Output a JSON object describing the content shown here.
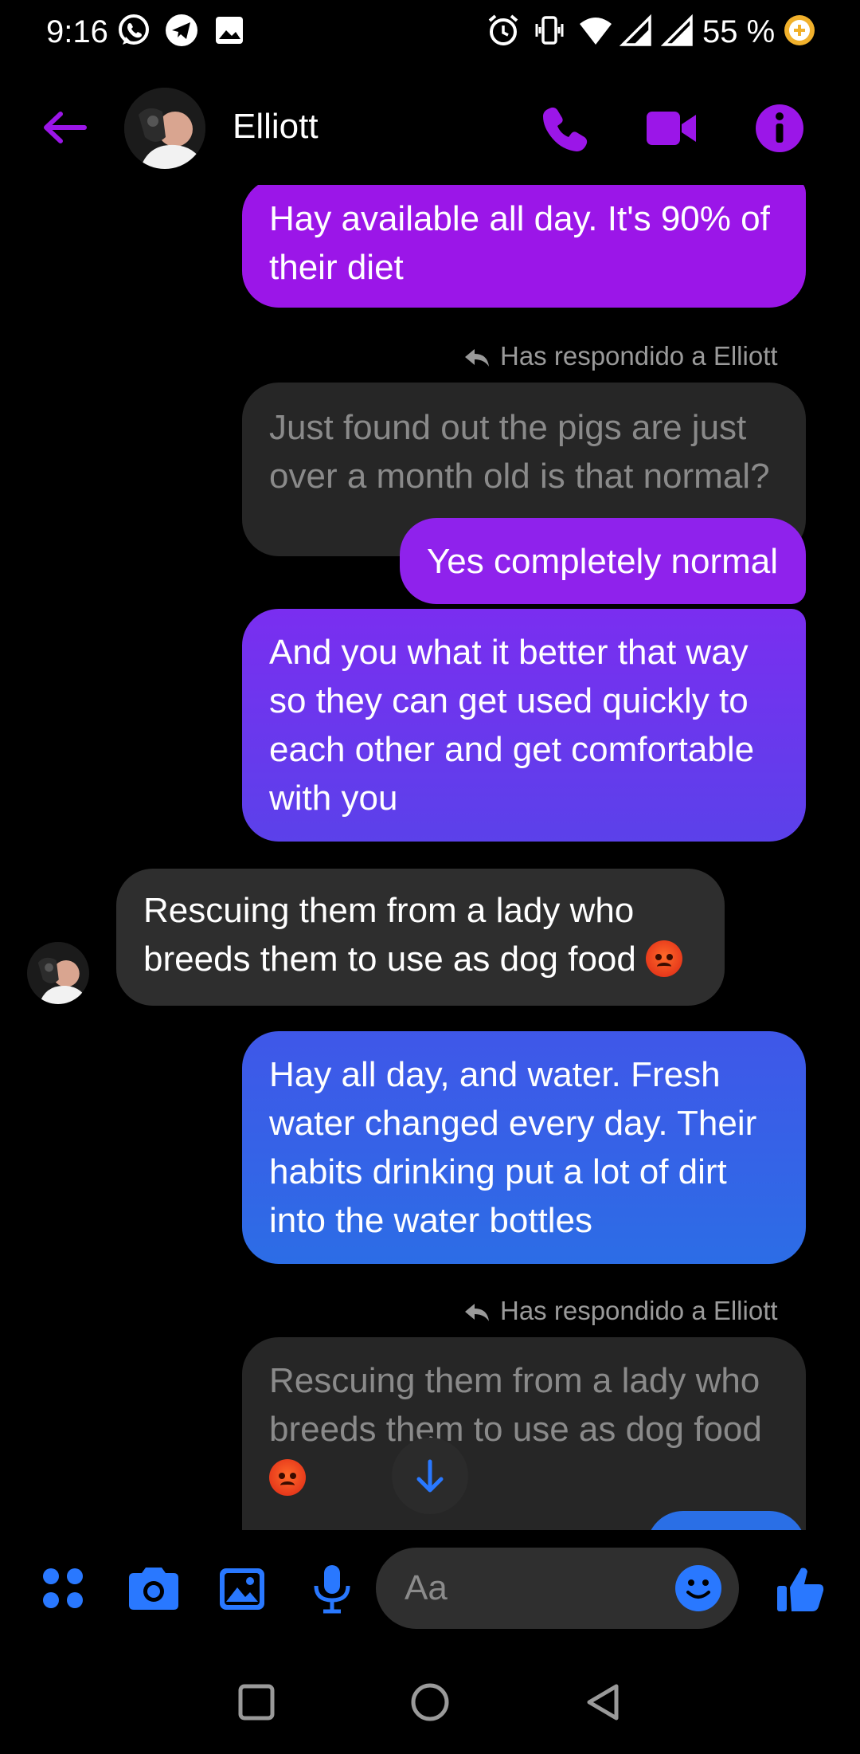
{
  "status_bar": {
    "time": "9:16",
    "battery": "55 %",
    "icons": [
      "whatsapp-icon",
      "telegram-icon",
      "gallery-icon",
      "alarm-icon",
      "vibrate-icon",
      "wifi-icon",
      "signal-icon",
      "signal-icon-2",
      "battery-saver-icon"
    ]
  },
  "header": {
    "contact_name": "Elliott",
    "icons": [
      "back-arrow-icon",
      "phone-icon",
      "video-call-icon",
      "info-icon"
    ],
    "accent_color": "#9b16e8"
  },
  "messages": [
    {
      "id": "m1",
      "side": "out",
      "text": "Hay available all day. It's 90% of their diet"
    },
    {
      "id": "r1",
      "type": "reply_label",
      "text": "Has respondido a Elliott"
    },
    {
      "id": "q1",
      "type": "quoted",
      "text": "Just found out the pigs are just over a month old is that normal?"
    },
    {
      "id": "m2",
      "side": "out",
      "text": "Yes completely normal"
    },
    {
      "id": "m3",
      "side": "out",
      "text": "And you what it better that way so they can get used quickly to each other and get comfortable with you"
    },
    {
      "id": "m4",
      "side": "in",
      "text": "Rescuing them from a lady who breeds them to use as dog food"
    },
    {
      "id": "m5",
      "side": "out",
      "text": "Hay all day, and water. Fresh water changed every day. Their habits drinking put a lot of dirt into the water bottles"
    },
    {
      "id": "r2",
      "type": "reply_label",
      "text": "Has respondido a Elliott"
    },
    {
      "id": "q2",
      "type": "quoted",
      "text": "Rescuing them from a lady who breeds them to use as dog food"
    }
  ],
  "composer": {
    "placeholder": "Aa",
    "icons": [
      "apps-icon",
      "camera-icon",
      "gallery-icon",
      "microphone-icon",
      "emoji-icon",
      "thumbs-up-icon"
    ],
    "accent_color": "#2978ff"
  },
  "nav_bar": {
    "icons": [
      "recents-icon",
      "home-icon",
      "back-icon"
    ]
  }
}
